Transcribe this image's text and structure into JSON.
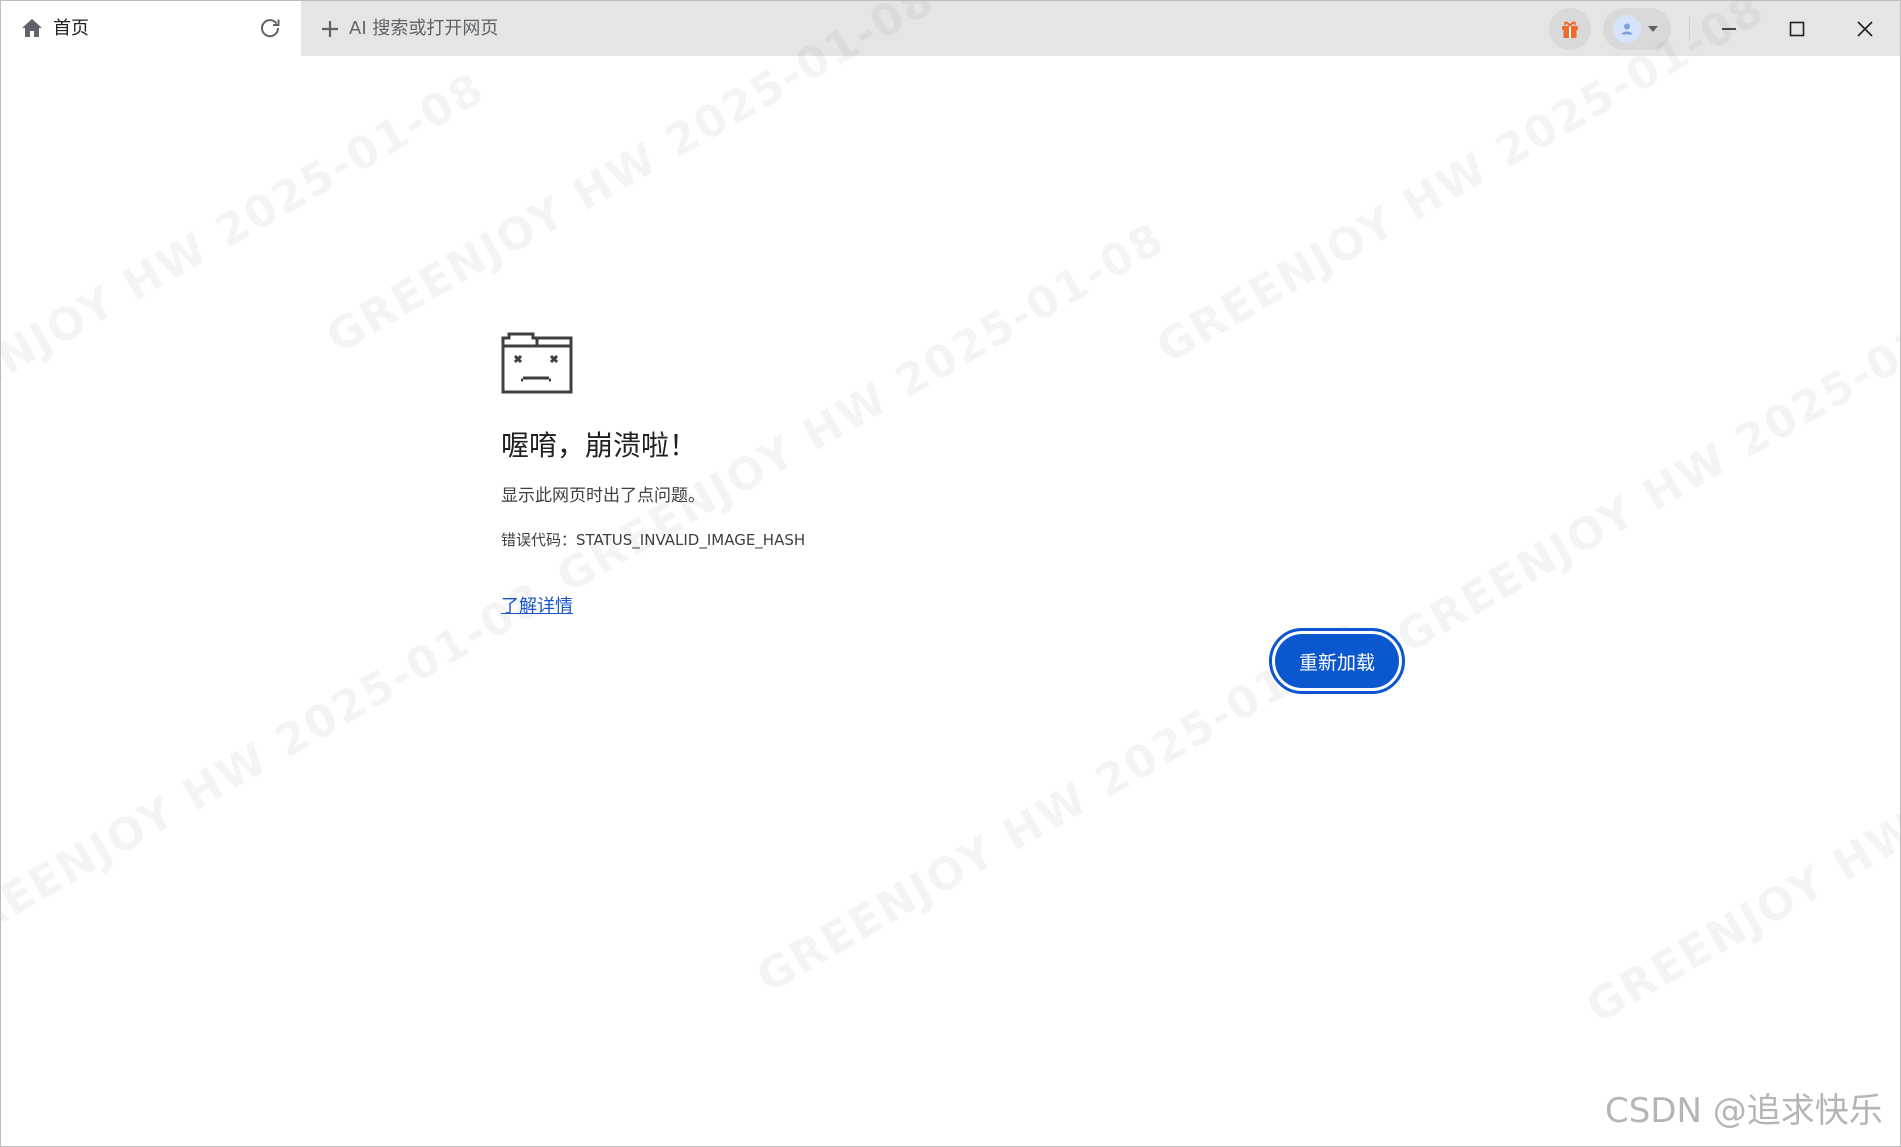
{
  "tabbar": {
    "home_tab_label": "首页",
    "home_icon": "home-icon",
    "reload_icon": "reload-icon",
    "newtab_label": "AI 搜索或打开网页",
    "newtab_icon": "plus-icon",
    "gift_icon": "gift-icon",
    "profile_icon": "avatar-icon",
    "window_controls": [
      "minimize-icon",
      "maximize-icon",
      "close-icon"
    ],
    "accent_gift": "#f06b2b"
  },
  "error": {
    "icon": "sad-folder-icon",
    "title": "喔唷，崩溃啦！",
    "description": "显示此网页时出了点问题。",
    "code_prefix": "错误代码：",
    "code": "STATUS_INVALID_IMAGE_HASH",
    "learn_more": "了解详情",
    "reload_button": "重新加载",
    "accent": "#0b57d0"
  },
  "watermark": {
    "text": "GREENJOY HW 2025-01-08"
  },
  "credit": "CSDN @追求快乐"
}
